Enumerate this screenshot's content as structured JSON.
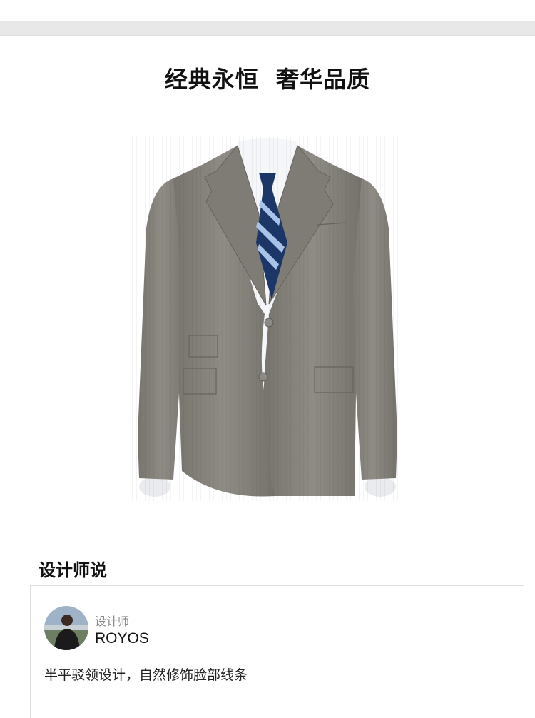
{
  "page": {
    "headline": "经典永恒  奢华品质"
  },
  "product": {
    "image_alt": "grey-two-button-suit-jacket"
  },
  "designer_section": {
    "title": "设计师说",
    "role_label": "设计师",
    "designer_name": "ROYOS",
    "quote": "半平驳领设计，自然修饰脸部线条"
  },
  "colors": {
    "suit": "#8a8780",
    "suit_shade": "#6f6c66",
    "shirt": "#f4f6f9",
    "tie_navy": "#1d3668",
    "tie_stripe": "#a9c3e8",
    "divider": "#e8e8e8",
    "card_border": "#dcdcdc"
  }
}
